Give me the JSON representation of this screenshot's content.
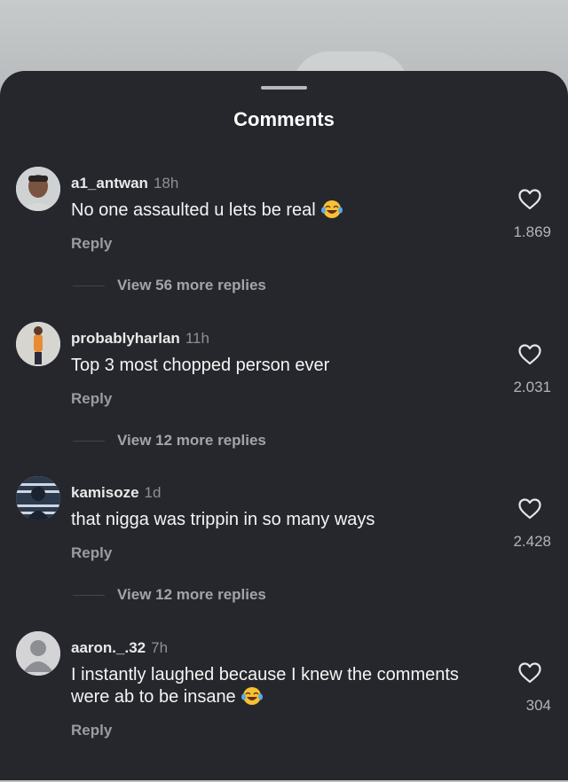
{
  "sheet": {
    "title": "Comments"
  },
  "comments": [
    {
      "username": "a1_antwan",
      "time": "18h",
      "text": "No one assaulted u lets be real",
      "emoji": "laughing-emoji",
      "reply_label": "Reply",
      "likes": "1.869",
      "view_more": "View 56 more replies"
    },
    {
      "username": "probablyharlan",
      "time": "11h",
      "text": "Top 3 most chopped person ever",
      "emoji": "",
      "reply_label": "Reply",
      "likes": "2.031",
      "view_more": "View 12 more replies"
    },
    {
      "username": "kamisoze",
      "time": "1d",
      "text": "that nigga was trippin in so many ways",
      "emoji": "",
      "reply_label": "Reply",
      "likes": "2.428",
      "view_more": "View 12 more replies"
    },
    {
      "username": "aaron._.32",
      "time": "7h",
      "text": "I instantly laughed because I knew the comments were ab to be insane",
      "emoji": "laughing-emoji",
      "reply_label": "Reply",
      "likes": "304",
      "view_more": ""
    }
  ],
  "colors": {
    "sheet_bg": "#26272c",
    "text": "#f4f4f5",
    "muted": "#9b9ca1"
  }
}
